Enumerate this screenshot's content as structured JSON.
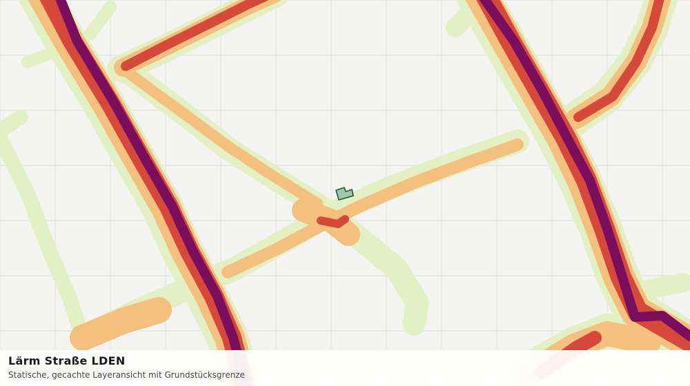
{
  "map": {
    "title": "Lärm Straße LDEN",
    "subtitle": "Statische, gecachte Layeransicht mit Grundstücksgrenze",
    "noise_band_colors": [
      "#e2f0c4",
      "#f4c07e",
      "#d6493a",
      "#7a0e5e"
    ],
    "background_color": "#f3f4f2",
    "grid_color": "#e0e2de",
    "parcel_fill": "#9fc7ae",
    "parcel_stroke": "#1e5a35"
  }
}
